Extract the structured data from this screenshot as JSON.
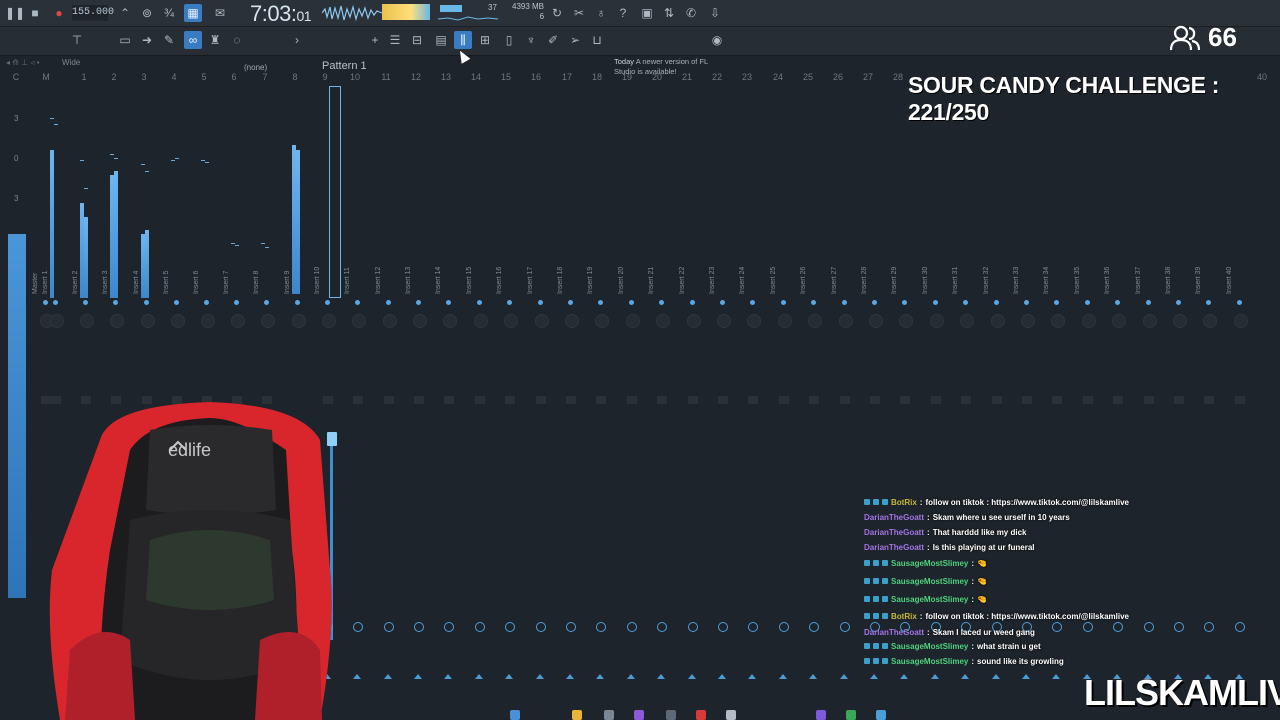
{
  "toolbar": {
    "tempo": "155.000",
    "clock_main": "7:03:",
    "clock_sub": "01",
    "cpu_value": "37",
    "memory_line1": "4393 MB",
    "memory_line2": "6",
    "pattern_label": "Pattern 1",
    "pattern_none": "(none)",
    "notice_title": "Today",
    "notice_text": "A newer version of FL Studio is available!",
    "view_label": "Wide"
  },
  "mixer": {
    "ruler": [
      "C",
      "M",
      "1",
      "2",
      "3",
      "4",
      "5",
      "6",
      "7",
      "8",
      "9",
      "10",
      "11",
      "12",
      "13",
      "14",
      "15",
      "16",
      "17",
      "18",
      "19",
      "20",
      "21",
      "22",
      "23",
      "24",
      "25",
      "26",
      "27",
      "28"
    ],
    "ruler_last": "40",
    "track_labels": [
      "Master",
      "Insert 1",
      "Insert 2",
      "Insert 3",
      "Insert 4",
      "Insert 5",
      "Insert 6",
      "Insert 7",
      "Insert 8",
      "Insert 9",
      "Insert 10",
      "Insert 11",
      "Insert 12",
      "Insert 13",
      "Insert 14",
      "Insert 15",
      "Insert 16",
      "Insert 17",
      "Insert 18",
      "Insert 19",
      "Insert 20",
      "Insert 21",
      "Insert 22",
      "Insert 23",
      "Insert 24",
      "Insert 25",
      "Insert 26",
      "Insert 27",
      "Insert 28",
      "Insert 29",
      "Insert 30",
      "Insert 31",
      "Insert 32",
      "Insert 33",
      "Insert 34",
      "Insert 35",
      "Insert 36",
      "Insert 37",
      "Insert 38",
      "Insert 39",
      "Insert 40"
    ],
    "scale_labels": [
      "3",
      "0",
      "3"
    ]
  },
  "overlay": {
    "viewer_count": "66",
    "challenge": "SOUR CANDY CHALLENGE : 221/250",
    "brand": "LILSKAMLIVE",
    "chair_logo": "edlife"
  },
  "chat": [
    {
      "user": "BotRix",
      "type": "bot",
      "msg": "follow on tiktok : https://www.tiktok.com/@lilskamlive"
    },
    {
      "user": "DarianTheGoatt",
      "type": "purple",
      "msg": "Skam where u see urself in 10 years"
    },
    {
      "user": "DarianTheGoatt",
      "type": "purple",
      "msg": "That harddd like my dick"
    },
    {
      "user": "DarianTheGoatt",
      "type": "purple",
      "msg": "Is this playing at ur funeral"
    },
    {
      "user": "SausageMostSlimey",
      "type": "green",
      "msg": "🤏"
    },
    {
      "user": "SausageMostSlimey",
      "type": "green",
      "msg": "🤏"
    },
    {
      "user": "SausageMostSlimey",
      "type": "green",
      "msg": "🤏"
    },
    {
      "user": "BotRix",
      "type": "bot",
      "msg": "follow on tiktok : https://www.tiktok.com/@lilskamlive"
    },
    {
      "user": "DarianTheGoatt",
      "type": "purple",
      "msg": "Skam I laced ur weed gang"
    },
    {
      "user": "SausageMostSlimey",
      "type": "green",
      "msg": "what strain u get"
    },
    {
      "user": "SausageMostSlimey",
      "type": "green",
      "msg": "sound like its growling"
    }
  ],
  "colors": {
    "accent": "#3a7cc2",
    "meter": "#4a96d8",
    "bg": "#1d242b"
  }
}
